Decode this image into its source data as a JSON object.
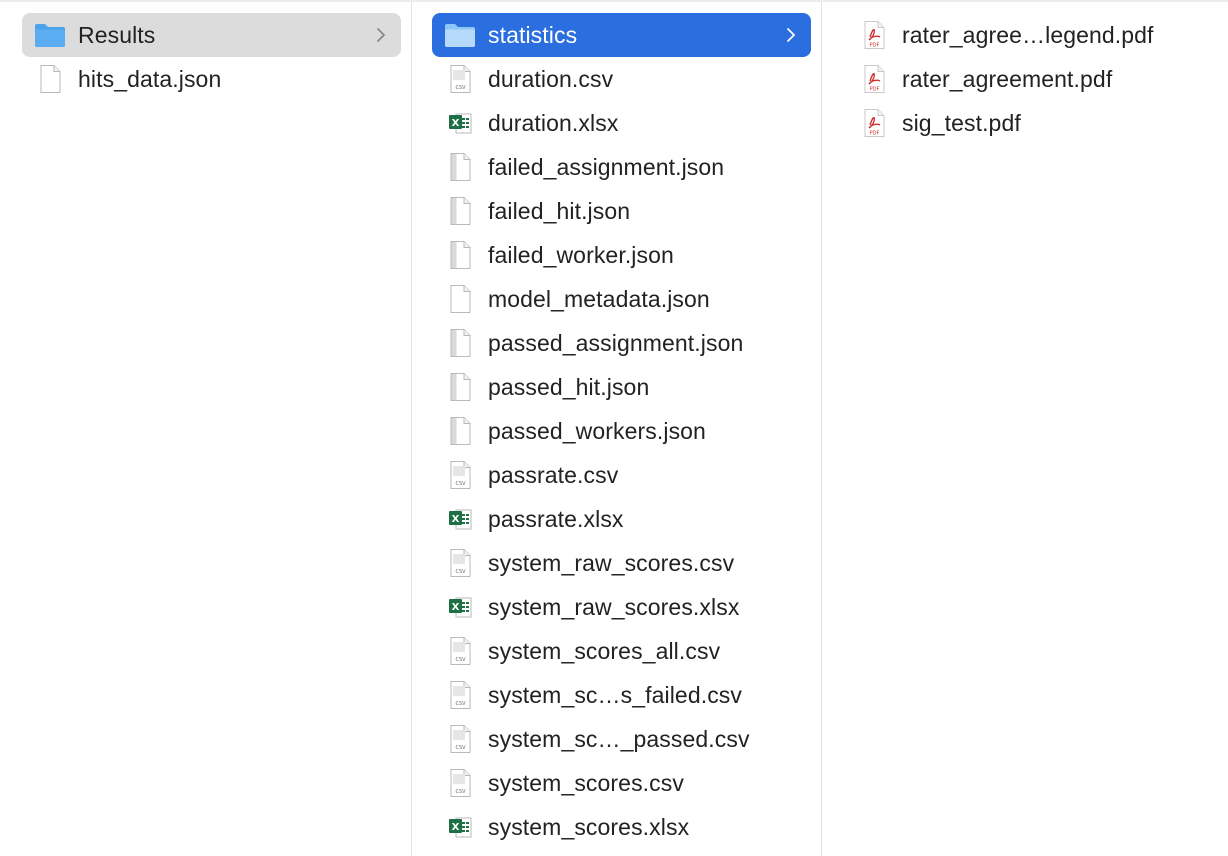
{
  "columns": [
    {
      "items": [
        {
          "label": "Results",
          "icon": "folder-icon",
          "selected": "gray",
          "chevron": true
        },
        {
          "label": "hits_data.json",
          "icon": "document-icon"
        }
      ]
    },
    {
      "items": [
        {
          "label": "statistics",
          "icon": "folder-icon",
          "selected": "blue",
          "chevron": true
        },
        {
          "label": "duration.csv",
          "icon": "csv-file-icon"
        },
        {
          "label": "duration.xlsx",
          "icon": "excel-file-icon"
        },
        {
          "label": "failed_assignment.json",
          "icon": "json-file-icon"
        },
        {
          "label": "failed_hit.json",
          "icon": "json-file-icon"
        },
        {
          "label": "failed_worker.json",
          "icon": "json-file-icon"
        },
        {
          "label": "model_metadata.json",
          "icon": "document-icon"
        },
        {
          "label": "passed_assignment.json",
          "icon": "json-file-icon"
        },
        {
          "label": "passed_hit.json",
          "icon": "json-file-icon"
        },
        {
          "label": "passed_workers.json",
          "icon": "json-file-icon"
        },
        {
          "label": "passrate.csv",
          "icon": "csv-file-icon"
        },
        {
          "label": "passrate.xlsx",
          "icon": "excel-file-icon"
        },
        {
          "label": "system_raw_scores.csv",
          "icon": "csv-file-icon"
        },
        {
          "label": "system_raw_scores.xlsx",
          "icon": "excel-file-icon"
        },
        {
          "label": "system_scores_all.csv",
          "icon": "csv-file-icon"
        },
        {
          "label": "system_sc…s_failed.csv",
          "icon": "csv-file-icon"
        },
        {
          "label": "system_sc…_passed.csv",
          "icon": "csv-file-icon"
        },
        {
          "label": "system_scores.csv",
          "icon": "csv-file-icon"
        },
        {
          "label": "system_scores.xlsx",
          "icon": "excel-file-icon"
        }
      ]
    },
    {
      "items": [
        {
          "label": "rater_agree…legend.pdf",
          "icon": "pdf-file-icon"
        },
        {
          "label": "rater_agreement.pdf",
          "icon": "pdf-file-icon"
        },
        {
          "label": "sig_test.pdf",
          "icon": "pdf-file-icon"
        }
      ]
    }
  ],
  "icon_text": {
    "csv": "CSV",
    "excel": "X",
    "pdf": "PDF"
  },
  "colors": {
    "selection_blue": "#2a6ee0",
    "selection_gray": "#dcdcdc",
    "folder": "#5aaef0",
    "excel": "#1e7145",
    "pdf": "#d0312d"
  }
}
